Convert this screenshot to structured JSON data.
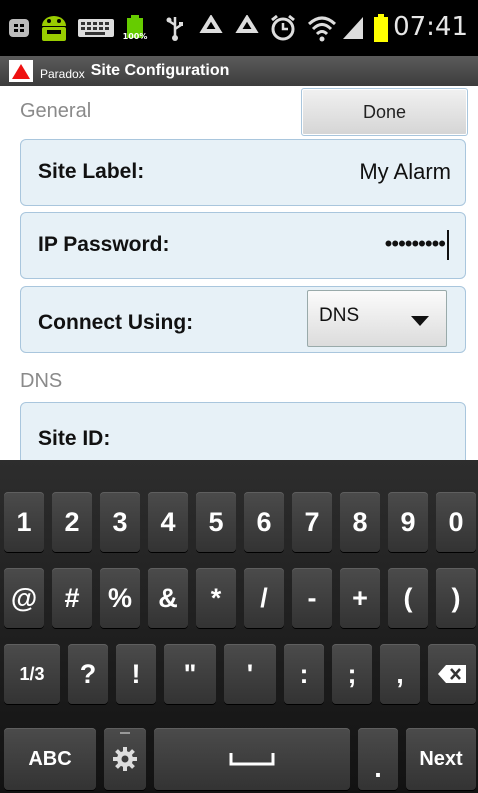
{
  "status_bar": {
    "time": "07:41",
    "battery_badge": "100%",
    "icons": [
      "bbm-icon",
      "android-debug-icon",
      "keyboard-icon",
      "battery-full-icon",
      "usb-icon",
      "recycle-icon",
      "recycle-icon",
      "alarm-clock-icon",
      "wifi-icon",
      "signal-icon",
      "battery-icon"
    ]
  },
  "title_bar": {
    "brand": "Paradox",
    "title": "Site Configuration"
  },
  "general": {
    "section_label": "General",
    "done_label": "Done"
  },
  "fields": {
    "site_label": {
      "label": "Site Label:",
      "value": "My Alarm"
    },
    "ip_password": {
      "label": "IP Password:",
      "value": "•••••••••"
    },
    "connect_using": {
      "label": "Connect Using:",
      "value": "DNS"
    }
  },
  "dns": {
    "section_label": "DNS",
    "site_id": {
      "label": "Site ID:"
    }
  },
  "keyboard": {
    "row1": [
      "1",
      "2",
      "3",
      "4",
      "5",
      "6",
      "7",
      "8",
      "9",
      "0"
    ],
    "row2": [
      "@",
      "#",
      "%",
      "&",
      "*",
      "/",
      "-",
      "+",
      "(",
      ")"
    ],
    "row3": {
      "page": "1/3",
      "keys": [
        "?",
        "!",
        "\"",
        "'",
        ":",
        ";",
        ","
      ],
      "backspace_icon": "backspace-icon"
    },
    "row4": {
      "abc": "ABC",
      "settings_icon": "gear-icon",
      "space_icon": "space-icon",
      "period": ".",
      "next": "Next"
    }
  },
  "colors": {
    "field_bg": "#e7f1f7",
    "field_border": "#a9c6dd",
    "title_bar": "#4a4a4a",
    "keyboard_bg": "#1f1f1f",
    "logo_red": "#e11"
  }
}
